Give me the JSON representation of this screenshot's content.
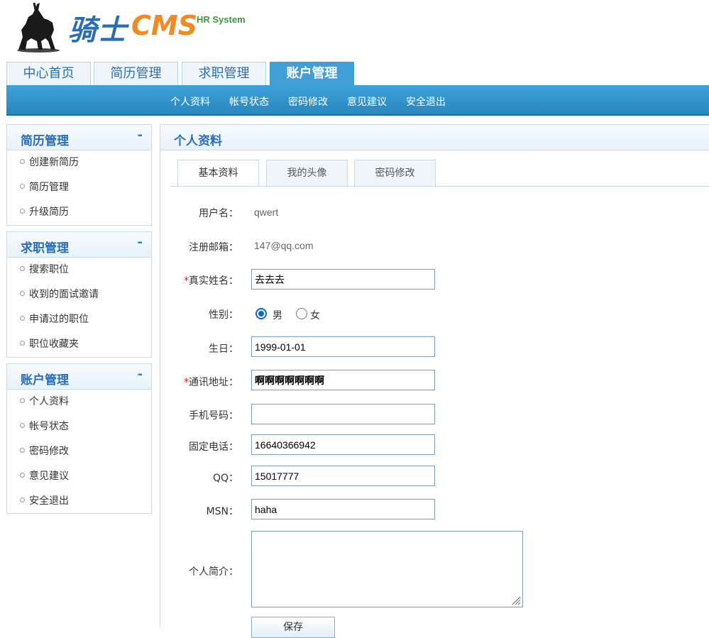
{
  "logo": {
    "cn_text": "骑士",
    "cms_text": "CMS",
    "tagline": "HR System"
  },
  "main_tabs": [
    {
      "label": "中心首页"
    },
    {
      "label": "简历管理"
    },
    {
      "label": "求职管理"
    },
    {
      "label": "账户管理",
      "active": true
    }
  ],
  "sub_nav": [
    "个人资料",
    "帐号状态",
    "密码修改",
    "意见建议",
    "安全退出"
  ],
  "sidebar": {
    "collapse_symbol": "-",
    "groups": [
      {
        "title": "简历管理",
        "items": [
          "创建新简历",
          "简历管理",
          "升级简历"
        ]
      },
      {
        "title": "求职管理",
        "items": [
          "搜索职位",
          "收到的面试邀请",
          "申请过的职位",
          "职位收藏夹"
        ]
      },
      {
        "title": "账户管理",
        "items": [
          "个人资料",
          "帐号状态",
          "密码修改",
          "意见建议",
          "安全退出"
        ]
      }
    ]
  },
  "content": {
    "title": "个人资料",
    "tabs": [
      {
        "label": "基本资料",
        "active": true
      },
      {
        "label": "我的头像"
      },
      {
        "label": "密码修改"
      }
    ],
    "form": {
      "username_label": "用户名：",
      "username_value": "qwert",
      "email_label": "注册邮箱：",
      "email_value": "147@qq.com",
      "realname_required": "*",
      "realname_label": "真实姓名：",
      "realname_value": "去去去",
      "gender_label": "性别：",
      "gender_male": "男",
      "gender_female": "女",
      "gender_selected": "男",
      "birthday_label": "生日：",
      "birthday_value": "1999-01-01",
      "address_required": "*",
      "address_label": "通讯地址：",
      "address_value": "啊啊啊啊啊啊啊",
      "mobile_label": "手机号码：",
      "mobile_value": "",
      "phone_label": "固定电话：",
      "phone_value": "16640366942",
      "qq_label": "QQ：",
      "qq_value": "15017777",
      "msn_label": "MSN：",
      "msn_value": "haha",
      "intro_label": "个人简介：",
      "intro_value": "",
      "save_label": "保存"
    }
  },
  "colors": {
    "brand_blue": "#2a6db5",
    "brand_orange": "#f08a24",
    "nav_bar": "#3da2d8",
    "required": "#d22222"
  }
}
